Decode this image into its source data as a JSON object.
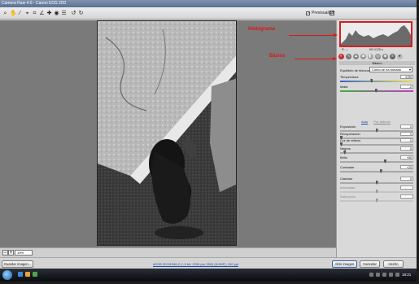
{
  "window": {
    "title": "Camera Raw 4.0 - Canon EOS 20D"
  },
  "toolbar": {
    "preview_label": "Previsualizar",
    "tools": [
      "zoom-icon",
      "hand-icon",
      "white-balance-icon",
      "color-sampler-icon",
      "crop-icon",
      "straighten-icon",
      "retouch-icon",
      "red-eye-icon",
      "preferences-icon",
      "rotate-left-icon",
      "rotate-right-icon"
    ]
  },
  "canvas": {
    "filename": "_MG_8711.CR2"
  },
  "zoom": {
    "level": "19%"
  },
  "histogram": {
    "readout_left": [
      "R:  ---",
      "G:  ---",
      "B:  ---"
    ],
    "readout_right": [
      "f/8    1/125 s",
      "ISO 400   18-55@50 mm"
    ]
  },
  "panel": {
    "section_title": "Básico",
    "wb_label": "Equilibrio de blancos:",
    "wb_value": "Como se ha tomado",
    "auto_link": "Auto",
    "default_link": "Por defecto",
    "sliders": [
      {
        "label": "Temperatura",
        "value": "4750",
        "pos": 0.43
      },
      {
        "label": "Matiz",
        "value": "-2",
        "pos": 0.49
      },
      {
        "label": "Exposición",
        "value": "0",
        "pos": 0.5
      },
      {
        "label": "Recuperación",
        "value": "0",
        "pos": 0.0
      },
      {
        "label": "Luz de relleno",
        "value": "0",
        "pos": 0.0
      },
      {
        "label": "Negros",
        "value": "5",
        "pos": 0.05
      },
      {
        "label": "Brillo",
        "value": "+50",
        "pos": 0.62
      },
      {
        "label": "Contraste",
        "value": "+25",
        "pos": 0.56
      },
      {
        "label": "Claridad",
        "value": "0",
        "pos": 0.5
      },
      {
        "label": "Intensidad",
        "value": "",
        "pos": 0.5,
        "disabled": true
      },
      {
        "label": "Saturación",
        "value": "",
        "pos": 0.5,
        "disabled": true
      }
    ]
  },
  "bottom": {
    "save_button": "Guardar imagen...",
    "workflow_link": "sRGB IEC61966-2.1; 8 bit; 2336 por 3504 (8,2MP); 240 ppi",
    "open_button": "Abrir imagen",
    "cancel_button": "Cancelar",
    "done_button": "Hecho"
  },
  "taskbar": {
    "clock": "18:21"
  },
  "annotations": {
    "histogram": "Histograma",
    "basic": "Básico"
  },
  "colors": {
    "annotation": "#e01515",
    "link": "#1f4fa8",
    "canvas": "#7a7a7a"
  }
}
